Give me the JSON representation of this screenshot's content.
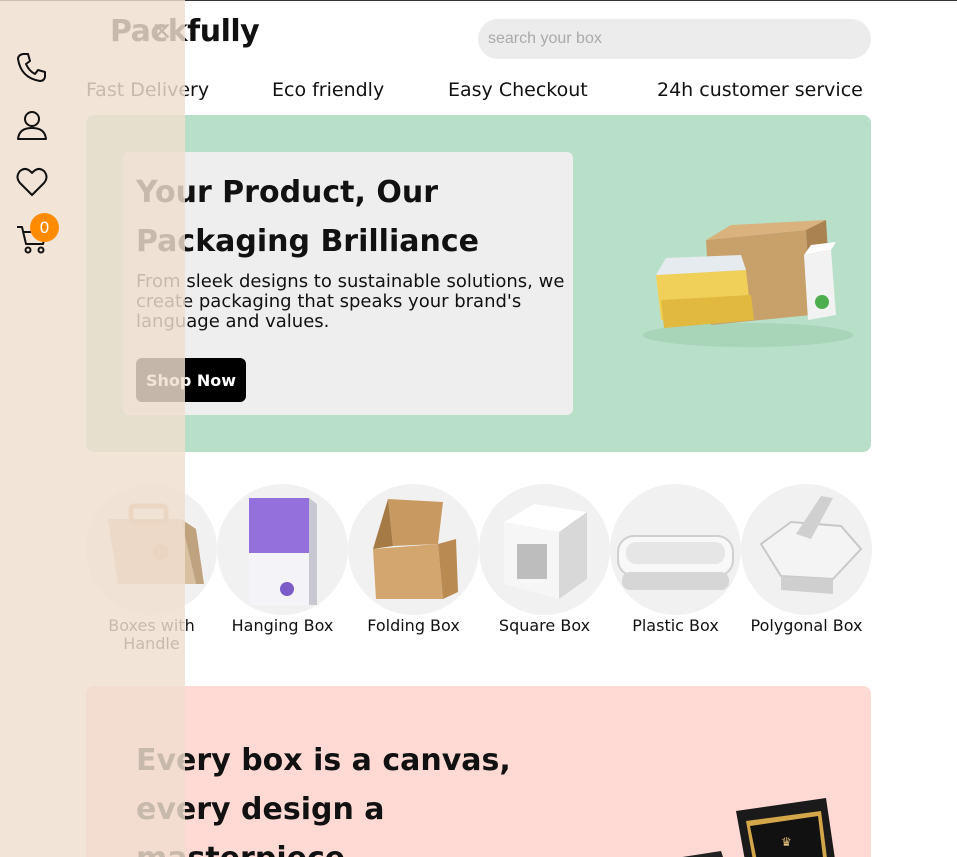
{
  "header": {
    "logo": "Packfully",
    "close_symbol": "×",
    "search_placeholder": "search your box"
  },
  "features": [
    "Fast Delivery",
    "Eco friendly",
    "Easy Checkout",
    "24h customer service"
  ],
  "hero": {
    "title": "Your Product, Our Packaging Brilliance",
    "subtitle": "From sleek designs to sustainable solutions, we create packaging that speaks your brand's language and values.",
    "button": "Shop Now",
    "bg_color": "#b8e0c8"
  },
  "categories": [
    {
      "label": "Boxes with Handle"
    },
    {
      "label": "Hanging Box"
    },
    {
      "label": "Folding Box"
    },
    {
      "label": "Square Box"
    },
    {
      "label": "Plastic Box"
    },
    {
      "label": "Polygonal Box"
    }
  ],
  "promo": {
    "title": "Every box is a canvas, every design a masterpiece",
    "bg_color": "#ffd9d4"
  },
  "sidebar": {
    "icons": [
      "phone-icon",
      "user-icon",
      "heart-icon",
      "cart-icon"
    ],
    "cart_count": "0",
    "badge_color": "#ff8c00"
  }
}
